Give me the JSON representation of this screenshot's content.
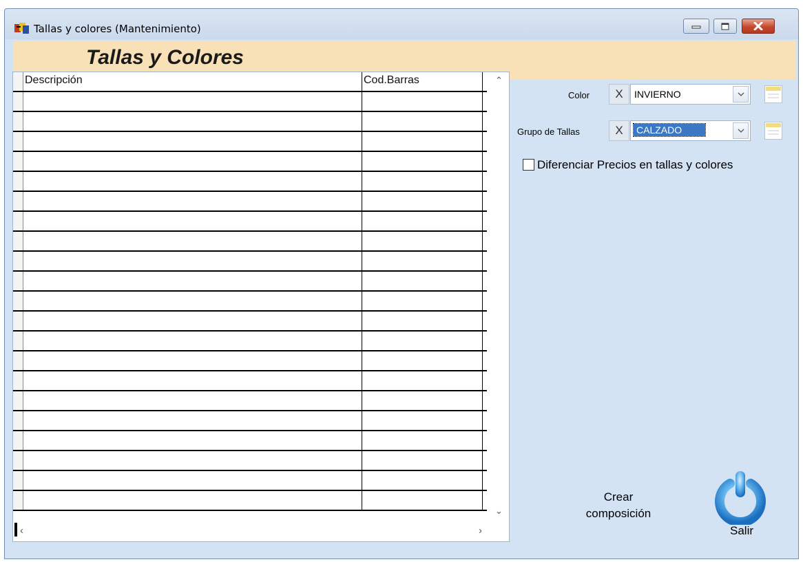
{
  "window": {
    "title": "Tallas y colores (Mantenimiento)",
    "header_title": "Tallas y Colores"
  },
  "grid": {
    "columns": [
      "Descripción",
      "Cod.Barras"
    ],
    "rows": []
  },
  "filters": {
    "color": {
      "label": "Color",
      "clear_label": "X",
      "value": "INVIERNO"
    },
    "grupo_tallas": {
      "label": "Grupo de Tallas",
      "clear_label": "X",
      "value": "CALZADO"
    }
  },
  "options": {
    "diferenciar_precios_label": "Diferenciar Precios en tallas y colores",
    "diferenciar_precios_checked": false
  },
  "actions": {
    "crear_line1": "Crear",
    "crear_line2": "composición",
    "salir_label": "Salir"
  },
  "icons": {
    "app": "app-window-icon",
    "lookup": "lookup-list-icon",
    "salir": "power-icon"
  },
  "colors": {
    "client_background": "#d3e3f4",
    "header_band": "#f8e1b6",
    "selection": "#3a78c6",
    "close_button": "#c4492e"
  }
}
